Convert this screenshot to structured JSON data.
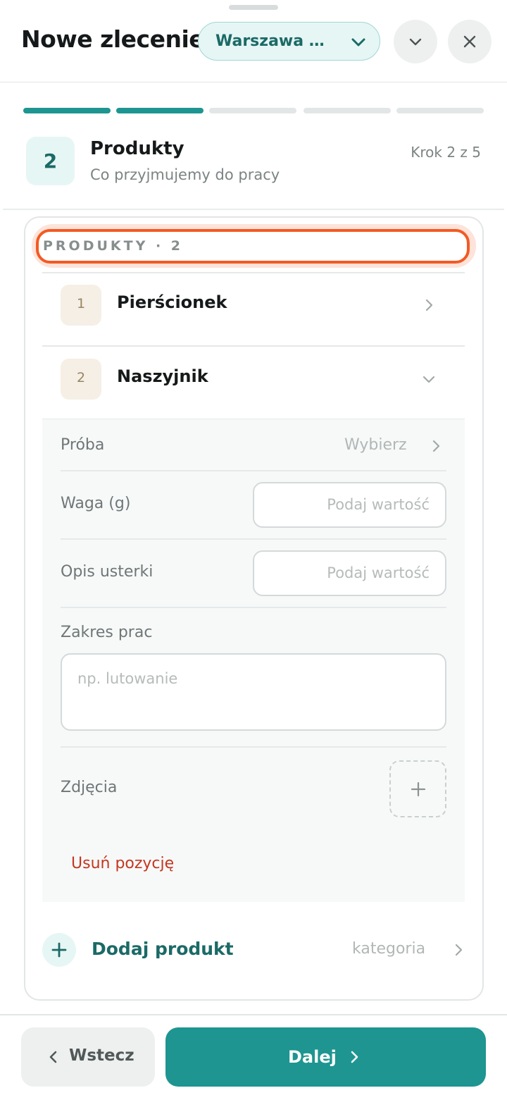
{
  "header": {
    "title": "Nowe zlecenie",
    "location": "Warszawa Centrum",
    "more_icon": "chevron-down-icon",
    "close_icon": "close-icon"
  },
  "progress": {
    "total_steps": 5,
    "completed_steps": 2
  },
  "step": {
    "number": "2",
    "title": "Produkty",
    "subtitle": "Co przyjmujemy do pracy",
    "counter": "Krok 2 z 5"
  },
  "products": {
    "section_label": "PRODUKTY · 2",
    "items": [
      {
        "index": "1",
        "name": "Pierścionek",
        "expanded": false
      },
      {
        "index": "2",
        "name": "Naszyjnik",
        "expanded": true
      }
    ],
    "form": {
      "proba_label": "Próba",
      "proba_value": "Wybierz",
      "waga_label": "Waga (g)",
      "waga_placeholder": "Podaj wartość",
      "opis_label": "Opis usterki",
      "opis_placeholder": "Podaj wartość",
      "zakres_label": "Zakres prac",
      "zakres_placeholder": "np. lutowanie",
      "zdjecia_label": "Zdjęcia",
      "remove_label": "Usuń pozycję"
    },
    "add_label": "Dodaj produkt",
    "add_category": "kategoria"
  },
  "footer": {
    "back_label": "Wstecz",
    "next_label": "Dalej"
  },
  "colors": {
    "accent": "#1e9590",
    "accent_dark": "#1b6a66",
    "highlight": "#f25a23",
    "danger": "#c4371f"
  }
}
